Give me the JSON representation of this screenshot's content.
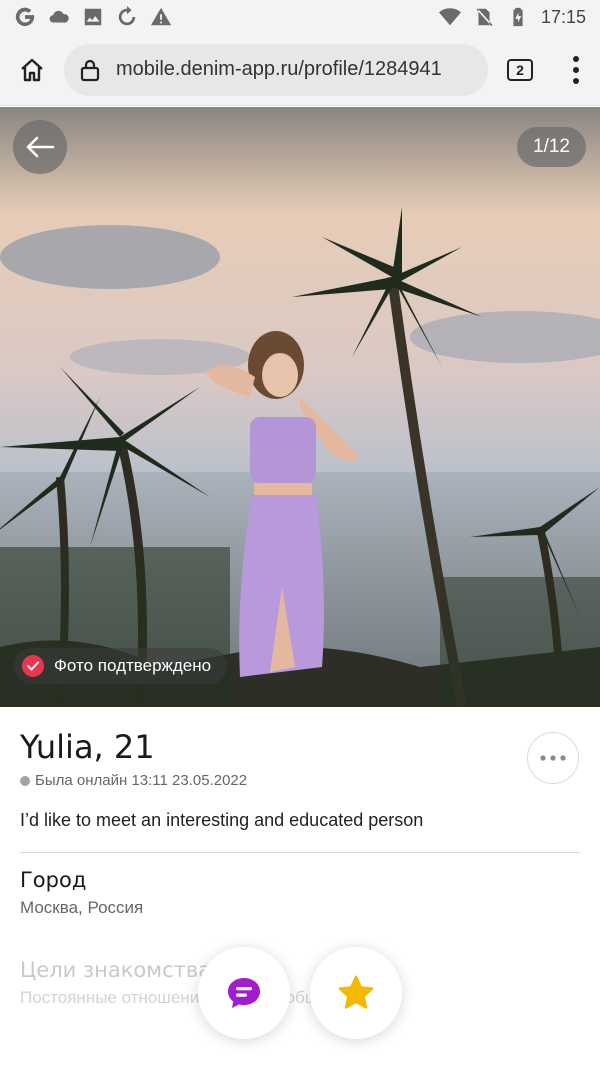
{
  "status_bar": {
    "left_icons": [
      "google-g-icon",
      "cloud-icon",
      "image-icon",
      "refresh-icon",
      "warning-icon"
    ],
    "right_icons": [
      "wifi-icon",
      "no-sim-icon",
      "battery-charging-icon"
    ],
    "time": "17:15"
  },
  "browser": {
    "url": "mobile.denim-app.ru/profile/1284941",
    "tab_count": "2"
  },
  "photo": {
    "counter": "1/12",
    "verified_label": "Фото подтверждено"
  },
  "profile": {
    "name": "Yulia, 21",
    "last_online": "Была онлайн 13:11 23.05.2022",
    "bio": "I’d like to meet an interesting and educated person",
    "city_label": "Город",
    "city_value": "Москва, Россия",
    "goals_label": "Цели знакомства",
    "goals_value": "Постоянные отношения, дружба, общение"
  },
  "colors": {
    "chat_accent": "#a11ccf",
    "star_accent": "#f5b800",
    "verified_red": "#e8364f"
  }
}
